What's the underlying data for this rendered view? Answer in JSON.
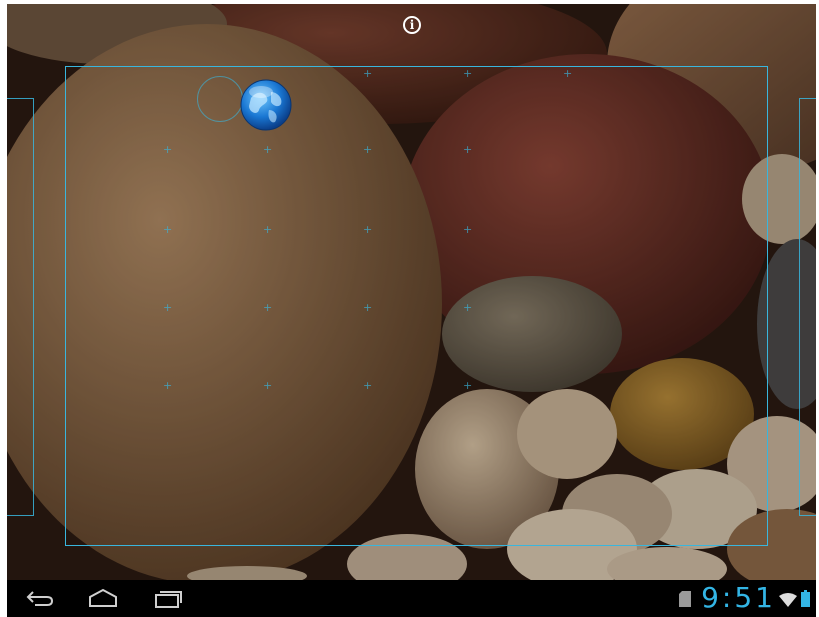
{
  "status": {
    "time": "9:51"
  },
  "icons": {
    "info": "info-icon",
    "globe": "browser-globe-icon",
    "back": "back-icon",
    "home": "home-icon",
    "recents": "recent-apps-icon",
    "sdcard": "sd-card-icon",
    "wifi": "wifi-icon",
    "battery": "battery-icon"
  },
  "colors": {
    "accent": "#33b5e5",
    "navbar": "#000000"
  }
}
